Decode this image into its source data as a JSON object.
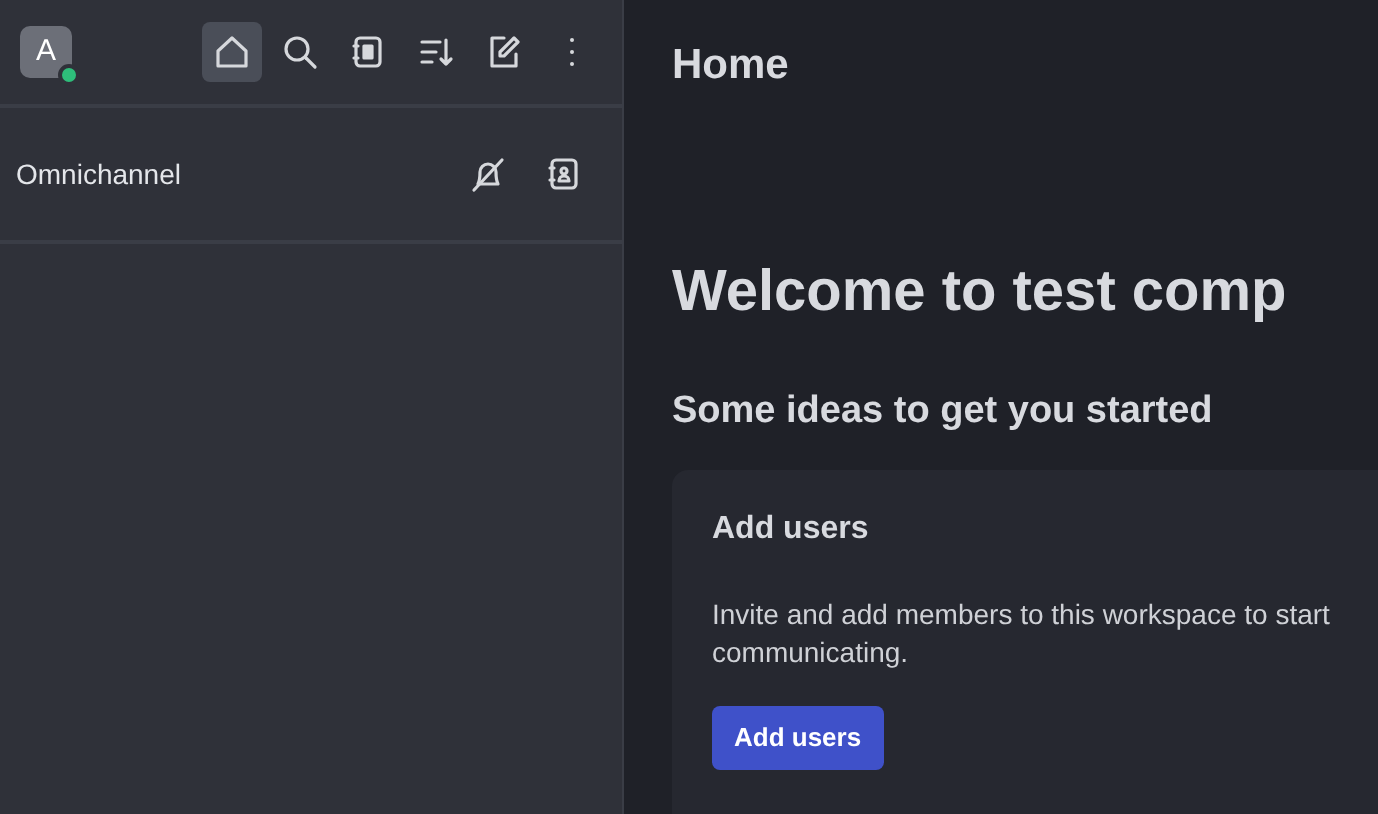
{
  "sidebar": {
    "avatar": {
      "initial": "A",
      "status_dot": {
        "color": "#2ebd7a"
      }
    },
    "toolbar": [
      {
        "kind": "home",
        "selected": true
      },
      {
        "kind": "search",
        "selected": false
      },
      {
        "kind": "directory",
        "selected": false
      },
      {
        "kind": "sort",
        "selected": false
      },
      {
        "kind": "write",
        "selected": false
      },
      {
        "kind": "more",
        "selected": false
      }
    ],
    "section": {
      "label": "Omnichannel",
      "actions": [
        {
          "kind": "agent-off"
        },
        {
          "kind": "contacts"
        }
      ]
    }
  },
  "main": {
    "title": "Home",
    "welcome": "Welcome to test comp",
    "subheading": "Some ideas to get you started",
    "cards": [
      {
        "title": "Add users",
        "text": "Invite and add members to this workspace to start communicating.",
        "button": "Add users"
      }
    ]
  }
}
